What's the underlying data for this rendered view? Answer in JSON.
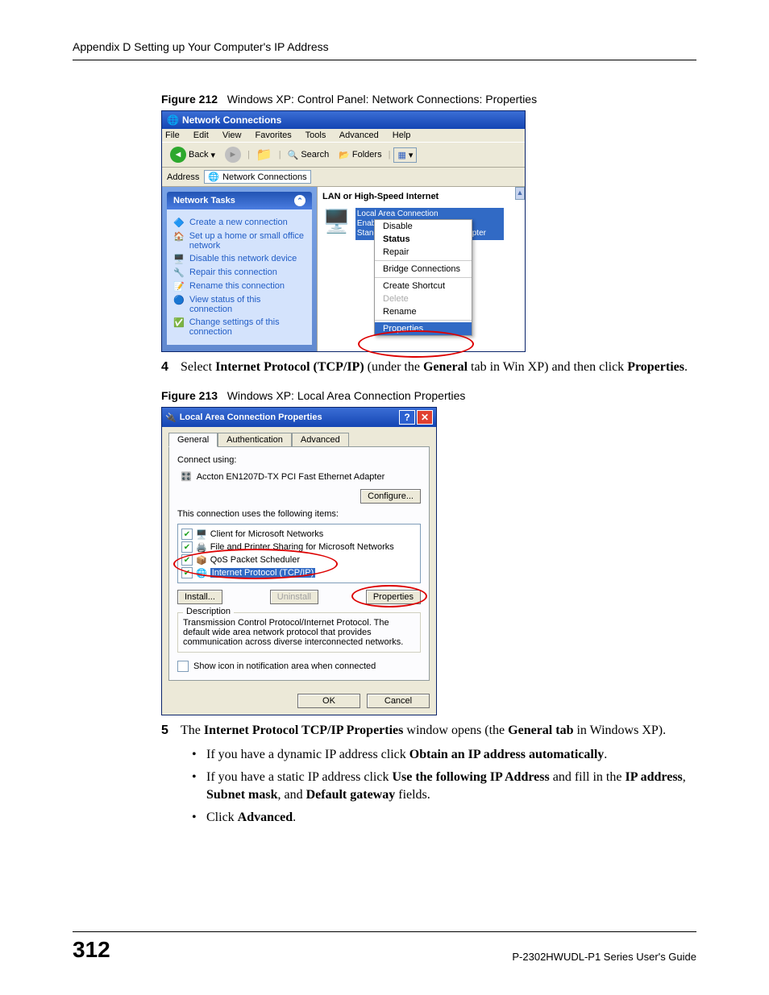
{
  "header": "Appendix D Setting up Your Computer's IP Address",
  "figure212": {
    "label": "Figure 212",
    "caption": "Windows XP: Control Panel: Network Connections: Properties"
  },
  "win1": {
    "title": "Network Connections",
    "menu": [
      "File",
      "Edit",
      "View",
      "Favorites",
      "Tools",
      "Advanced",
      "Help"
    ],
    "toolbar": {
      "back": "Back",
      "search": "Search",
      "folders": "Folders"
    },
    "address_label": "Address",
    "address_value": "Network Connections",
    "tasks_title": "Network Tasks",
    "tasks": [
      "Create a new connection",
      "Set up a home or small office network",
      "Disable this network device",
      "Repair this connection",
      "Rename this connection",
      "View status of this connection",
      "Change settings of this connection"
    ],
    "section": "LAN or High-Speed Internet",
    "conn": {
      "name": "Local Area Connection",
      "status": "Enabled",
      "device": "Standard PCI Fast Ethernet Adapter"
    },
    "context": [
      "Disable",
      "Status",
      "Repair",
      "Bridge Connections",
      "Create Shortcut",
      "Delete",
      "Rename",
      "Properties"
    ]
  },
  "step4": {
    "num": "4",
    "text_pre": "Select ",
    "bold1": "Internet Protocol (TCP/IP)",
    "mid1": " (under the ",
    "bold2": "General",
    "mid2": " tab in Win XP) and then click ",
    "bold3": "Properties",
    "post": "."
  },
  "figure213": {
    "label": "Figure 213",
    "caption": "Windows XP: Local Area Connection Properties"
  },
  "win2": {
    "title": "Local Area Connection Properties",
    "tabs": [
      "General",
      "Authentication",
      "Advanced"
    ],
    "connect_using": "Connect using:",
    "adapter": "Accton EN1207D-TX PCI Fast Ethernet Adapter",
    "configure": "Configure...",
    "uses_label": "This connection uses the following items:",
    "items": [
      "Client for Microsoft Networks",
      "File and Printer Sharing for Microsoft Networks",
      "QoS Packet Scheduler",
      "Internet Protocol (TCP/IP)"
    ],
    "btns": {
      "install": "Install...",
      "uninstall": "Uninstall",
      "properties": "Properties"
    },
    "desc_label": "Description",
    "desc_text": "Transmission Control Protocol/Internet Protocol. The default wide area network protocol that provides communication across diverse interconnected networks.",
    "show_icon": "Show icon in notification area when connected",
    "ok": "OK",
    "cancel": "Cancel"
  },
  "step5": {
    "num": "5",
    "pre": "The ",
    "b1": "Internet Protocol TCP/IP Properties",
    "mid1": " window opens (the ",
    "b2": "General tab",
    "mid2": " in Windows XP)."
  },
  "bullets": {
    "b1": {
      "pre": "If you have a dynamic IP address click ",
      "bold": "Obtain an IP address automatically",
      "post": "."
    },
    "b2": {
      "pre": "If you have a static IP address click ",
      "bold1": "Use the following IP Address",
      "mid": " and fill in the ",
      "bold2": "IP address",
      "c1": ", ",
      "bold3": "Subnet mask",
      "c2": ", and ",
      "bold4": "Default gateway",
      "post": " fields."
    },
    "b3": {
      "pre": "Click ",
      "bold": "Advanced",
      "post": "."
    }
  },
  "footer": {
    "page": "312",
    "guide": "P-2302HWUDL-P1 Series User's Guide"
  }
}
